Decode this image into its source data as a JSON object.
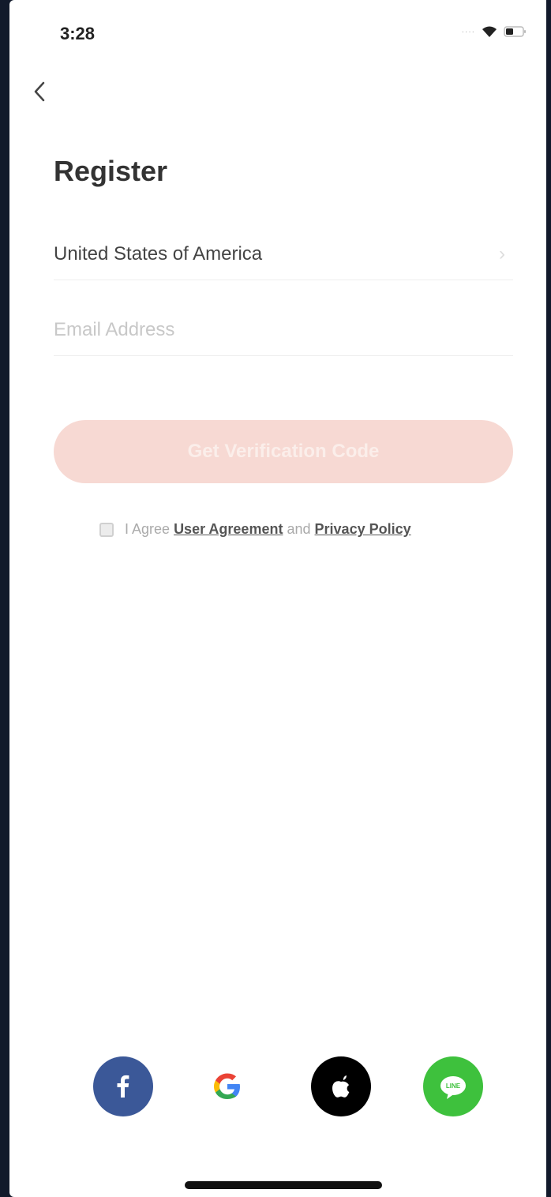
{
  "status_bar": {
    "time": "3:28",
    "signal": "····"
  },
  "header": {
    "title": "Register"
  },
  "form": {
    "country": "United States of America",
    "email_placeholder": "Email Address",
    "email_value": "",
    "submit_label": "Get Verification Code"
  },
  "agreement": {
    "prefix": "I Agree",
    "user_agreement": "User Agreement",
    "conjunction": "and",
    "privacy_policy": "Privacy Policy",
    "checked": false
  },
  "social": [
    {
      "name": "facebook",
      "icon": "facebook-icon",
      "color": "#3b5898"
    },
    {
      "name": "google",
      "icon": "google-icon",
      "color": "#ffffff"
    },
    {
      "name": "apple",
      "icon": "apple-icon",
      "color": "#000000"
    },
    {
      "name": "line",
      "icon": "line-icon",
      "color": "#3ec13d"
    }
  ],
  "colors": {
    "accent_disabled": "#f7d9d3",
    "background": "#ffffff"
  }
}
